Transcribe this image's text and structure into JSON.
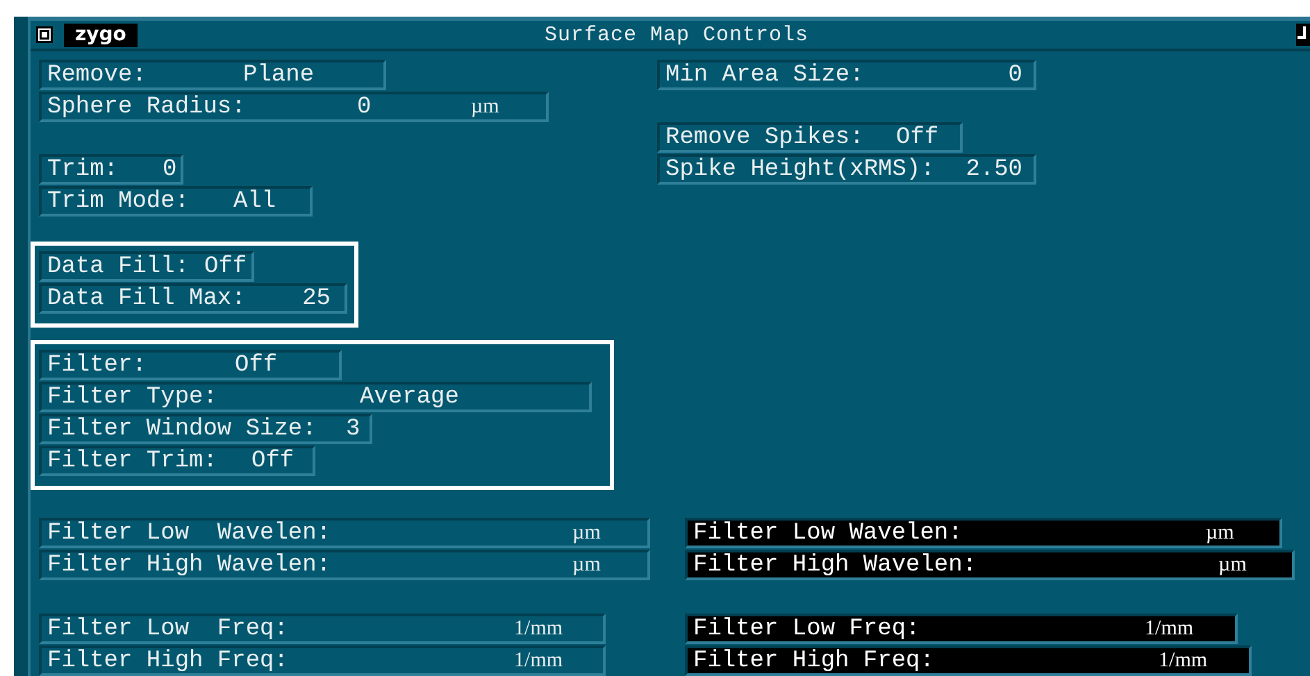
{
  "window": {
    "logo": "zygo",
    "title": "Surface Map Controls"
  },
  "top_left": [
    {
      "highlighted": false,
      "fields": [
        {
          "label": "Remove:",
          "value": "Plane",
          "disabled": false
        },
        {
          "label": "Sphere Radius:",
          "value": "0",
          "unit": "µm",
          "disabled": false
        }
      ]
    },
    {
      "highlighted": false,
      "fields": [
        {
          "label": "Trim:",
          "value": "0",
          "disabled": false
        },
        {
          "label": "Trim Mode:",
          "value": "All",
          "disabled": false
        }
      ]
    },
    {
      "highlighted": true,
      "fields": [
        {
          "label": "Data Fill:",
          "value": "Off",
          "disabled": false
        },
        {
          "label": "Data Fill Max:",
          "value": "25",
          "disabled": false
        }
      ]
    },
    {
      "highlighted": true,
      "fields": [
        {
          "label": "Filter:",
          "value": "Off",
          "disabled": false
        },
        {
          "label": "Filter Type:",
          "value": "Average",
          "disabled": false
        },
        {
          "label": "Filter Window Size:",
          "value": "3",
          "disabled": false
        },
        {
          "label": "Filter Trim:",
          "value": "Off",
          "disabled": false
        }
      ]
    }
  ],
  "top_right": [
    {
      "highlighted": false,
      "fields": [
        {
          "label": "Min Area Size:",
          "value": "0",
          "disabled": false
        }
      ]
    },
    {
      "highlighted": false,
      "fields": [
        {
          "label": "Remove Spikes:",
          "value": "Off",
          "disabled": false
        },
        {
          "label": "Spike Height(xRMS):",
          "value": "2.50",
          "disabled": false
        }
      ]
    }
  ],
  "bottom_left": [
    {
      "highlighted": false,
      "fields": [
        {
          "label": "Filter Low  Wavelen:",
          "unit": "µm",
          "disabled": false
        },
        {
          "label": "Filter High Wavelen:",
          "unit": "µm",
          "disabled": false
        }
      ]
    },
    {
      "highlighted": false,
      "fields": [
        {
          "label": "Filter Low  Freq:",
          "unit": "1/mm",
          "disabled": false
        },
        {
          "label": "Filter High Freq:",
          "unit": "1/mm",
          "disabled": false
        }
      ]
    }
  ],
  "bottom_right": [
    {
      "highlighted": false,
      "fields": [
        {
          "label": "Filter Low Wavelen:",
          "unit": "µm",
          "disabled": true
        },
        {
          "label": "Filter High Wavelen:",
          "unit": "µm",
          "disabled": true
        }
      ]
    },
    {
      "highlighted": false,
      "fields": [
        {
          "label": "Filter Low Freq:",
          "unit": "1/mm",
          "disabled": true
        },
        {
          "label": "Filter High Freq:",
          "unit": "1/mm",
          "disabled": true
        }
      ]
    }
  ]
}
